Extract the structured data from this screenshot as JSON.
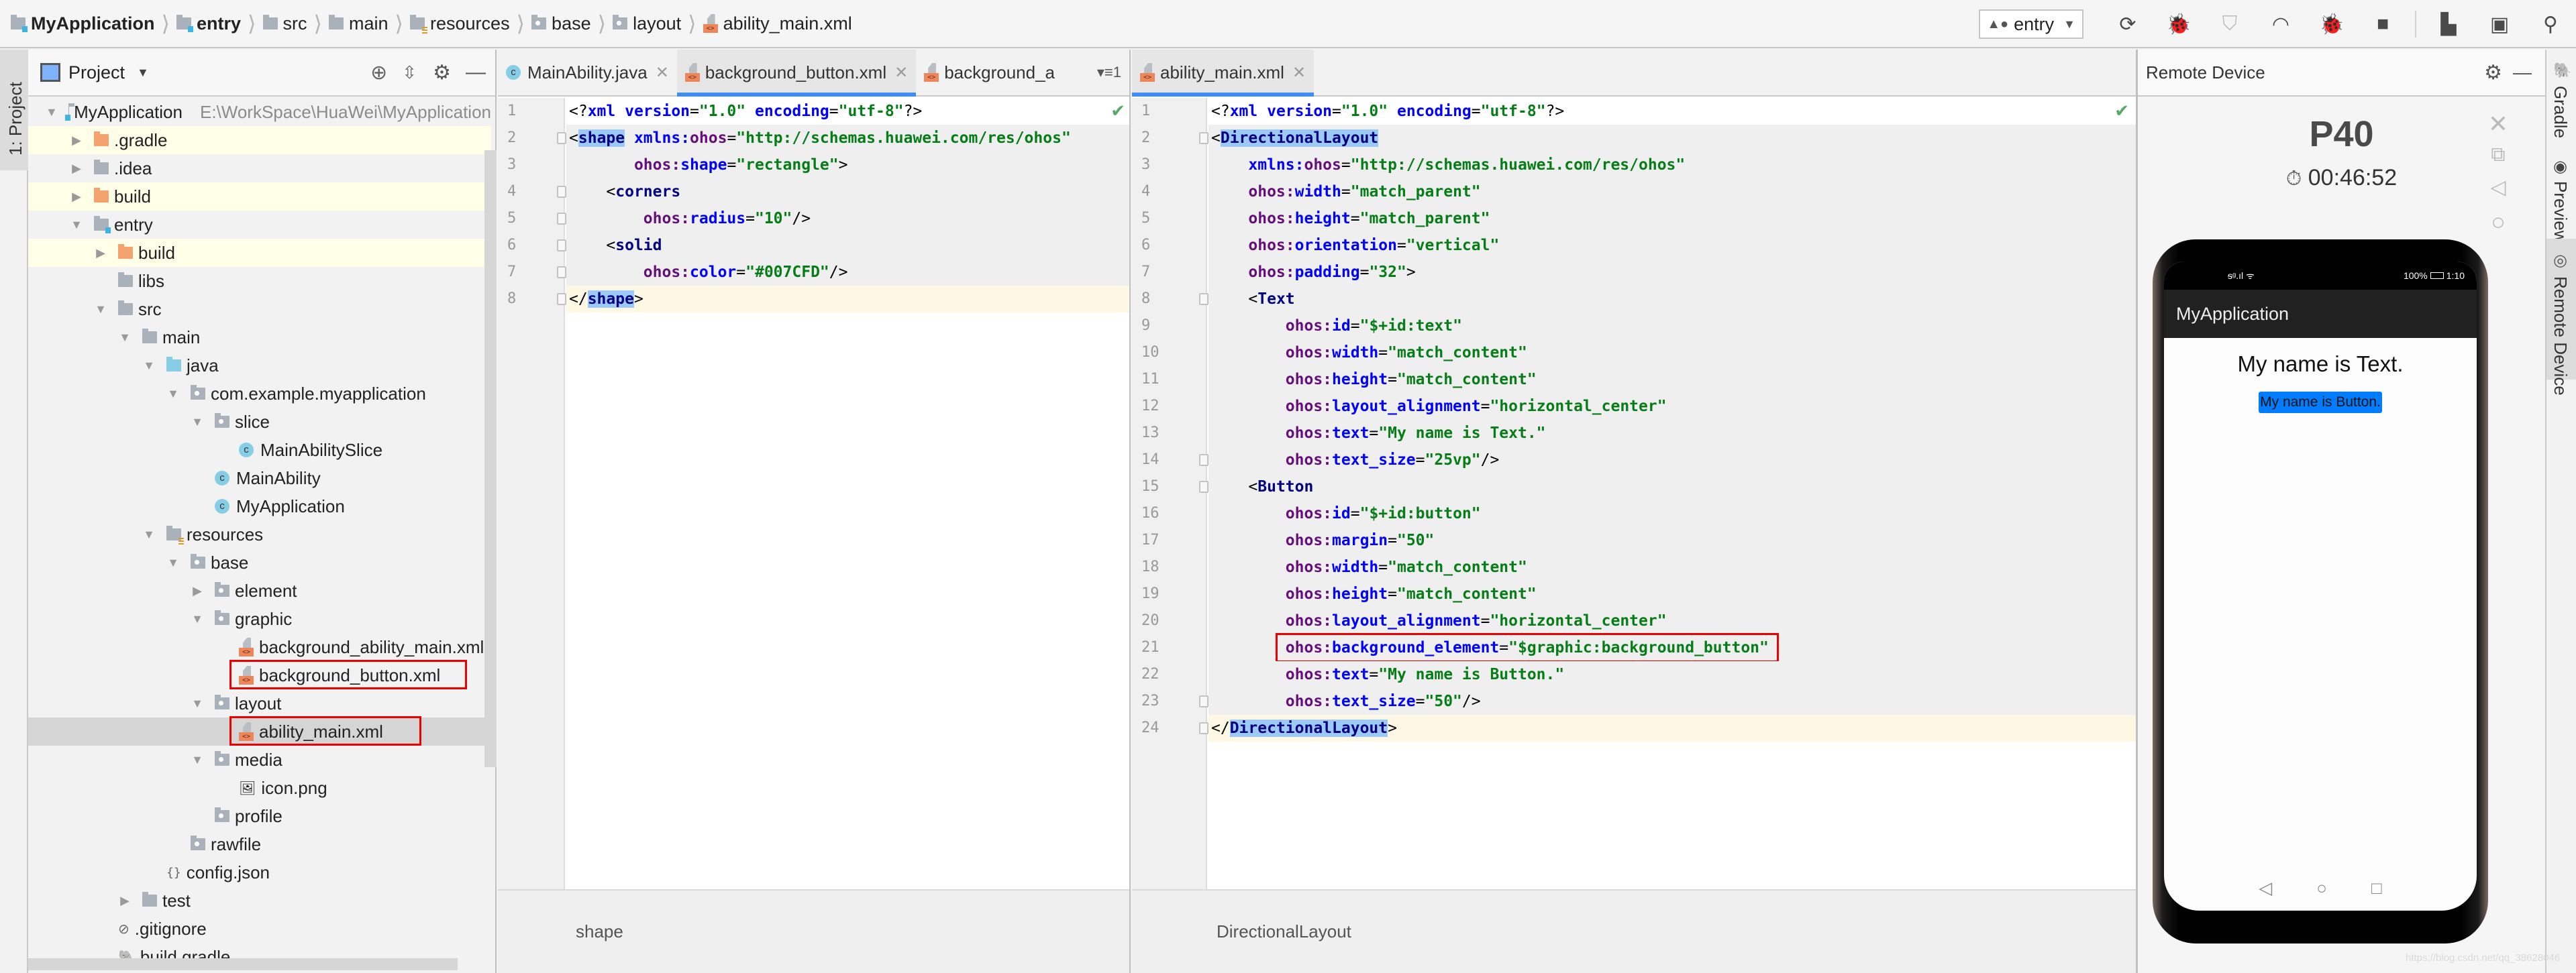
{
  "breadcrumb": {
    "items": [
      {
        "label": "MyApplication",
        "icon": "module-folder-icon",
        "bold": true
      },
      {
        "label": "entry",
        "icon": "module-folder-icon",
        "bold": true
      },
      {
        "label": "src",
        "icon": "folder-icon"
      },
      {
        "label": "main",
        "icon": "folder-icon"
      },
      {
        "label": "resources",
        "icon": "resources-folder-icon"
      },
      {
        "label": "base",
        "icon": "package-folder-icon"
      },
      {
        "label": "layout",
        "icon": "package-folder-icon"
      },
      {
        "label": "ability_main.xml",
        "icon": "xml-file-icon"
      }
    ]
  },
  "toolbar": {
    "run_config": "entry",
    "buttons": [
      "rerun-icon",
      "debug-icon",
      "coverage-icon",
      "profile-icon",
      "attach-debugger-icon",
      "stop-icon",
      "project-structure-icon",
      "device-manager-icon",
      "search-icon"
    ]
  },
  "left_strip": {
    "project_tab": "1: Project"
  },
  "project_panel": {
    "title": "Project",
    "tree": [
      {
        "label": "MyApplication",
        "hint": "E:\\WorkSpace\\HuaWei\\MyApplication",
        "depth": 0,
        "arrow": "down",
        "icon": "module"
      },
      {
        "label": ".gradle",
        "depth": 1,
        "arrow": "right",
        "icon": "orange",
        "highlight": "yellow"
      },
      {
        "label": ".idea",
        "depth": 1,
        "arrow": "right",
        "icon": "folder"
      },
      {
        "label": "build",
        "depth": 1,
        "arrow": "right",
        "icon": "orange",
        "highlight": "yellow"
      },
      {
        "label": "entry",
        "depth": 1,
        "arrow": "down",
        "icon": "module"
      },
      {
        "label": "build",
        "depth": 2,
        "arrow": "right",
        "icon": "orange",
        "highlight": "yellow"
      },
      {
        "label": "libs",
        "depth": 2,
        "arrow": "",
        "icon": "folder"
      },
      {
        "label": "src",
        "depth": 2,
        "arrow": "down",
        "icon": "folder"
      },
      {
        "label": "main",
        "depth": 3,
        "arrow": "down",
        "icon": "folder"
      },
      {
        "label": "java",
        "depth": 4,
        "arrow": "down",
        "icon": "java"
      },
      {
        "label": "com.example.myapplication",
        "depth": 5,
        "arrow": "down",
        "icon": "package"
      },
      {
        "label": "slice",
        "depth": 6,
        "arrow": "down",
        "icon": "package"
      },
      {
        "label": "MainAbilitySlice",
        "depth": 7,
        "arrow": "",
        "icon": "class"
      },
      {
        "label": "MainAbility",
        "depth": 6,
        "arrow": "",
        "icon": "class"
      },
      {
        "label": "MyApplication",
        "depth": 6,
        "arrow": "",
        "icon": "class"
      },
      {
        "label": "resources",
        "depth": 4,
        "arrow": "down",
        "icon": "resources"
      },
      {
        "label": "base",
        "depth": 5,
        "arrow": "down",
        "icon": "package"
      },
      {
        "label": "element",
        "depth": 6,
        "arrow": "right",
        "icon": "package"
      },
      {
        "label": "graphic",
        "depth": 6,
        "arrow": "down",
        "icon": "package"
      },
      {
        "label": "background_ability_main.xml",
        "depth": 7,
        "arrow": "",
        "icon": "xml"
      },
      {
        "label": "background_button.xml",
        "depth": 7,
        "arrow": "",
        "icon": "xml",
        "boxed": true
      },
      {
        "label": "layout",
        "depth": 6,
        "arrow": "down",
        "icon": "package"
      },
      {
        "label": "ability_main.xml",
        "depth": 7,
        "arrow": "",
        "icon": "xml",
        "boxed": true,
        "selected": true
      },
      {
        "label": "media",
        "depth": 6,
        "arrow": "down",
        "icon": "package"
      },
      {
        "label": "icon.png",
        "depth": 7,
        "arrow": "",
        "icon": "image"
      },
      {
        "label": "profile",
        "depth": 6,
        "arrow": "",
        "icon": "package"
      },
      {
        "label": "rawfile",
        "depth": 5,
        "arrow": "",
        "icon": "package"
      },
      {
        "label": "config.json",
        "depth": 4,
        "arrow": "",
        "icon": "json"
      },
      {
        "label": "test",
        "depth": 3,
        "arrow": "right",
        "icon": "folder"
      },
      {
        "label": ".gitignore",
        "depth": 2,
        "arrow": "",
        "icon": "gitignore"
      },
      {
        "label": "build.gradle",
        "depth": 2,
        "arrow": "",
        "icon": "gradle"
      }
    ]
  },
  "editor_left": {
    "tabs": [
      {
        "label": "MainAbility.java",
        "icon": "class",
        "closable": true
      },
      {
        "label": "background_button.xml",
        "icon": "xml",
        "closable": true,
        "active": true
      },
      {
        "label": "background_a",
        "icon": "xml",
        "closable": false
      }
    ],
    "overflow_label": "1",
    "lines": [
      [
        [
          "pun",
          "<?"
        ],
        [
          "attr",
          "xml version"
        ],
        [
          "pun",
          "="
        ],
        [
          "val",
          "\"1.0\""
        ],
        [
          "attr",
          " encoding"
        ],
        [
          "pun",
          "="
        ],
        [
          "val",
          "\"utf-8\""
        ],
        [
          "pun",
          "?>"
        ]
      ],
      [
        [
          "pun",
          "<"
        ],
        [
          "tag",
          "shape"
        ],
        [
          "attr",
          " xmlns:"
        ],
        [
          "ns",
          "ohos"
        ],
        [
          "pun",
          "="
        ],
        [
          "val",
          "\"http://schemas.huawei.com/res/ohos\""
        ]
      ],
      [
        [
          "pun",
          "       "
        ],
        [
          "ns",
          "ohos:"
        ],
        [
          "attr",
          "shape"
        ],
        [
          "pun",
          "="
        ],
        [
          "val",
          "\"rectangle\""
        ],
        [
          "pun",
          ">"
        ]
      ],
      [
        [
          "pun",
          "    <"
        ],
        [
          "tag",
          "corners"
        ]
      ],
      [
        [
          "pun",
          "        "
        ],
        [
          "ns",
          "ohos:"
        ],
        [
          "attr",
          "radius"
        ],
        [
          "pun",
          "="
        ],
        [
          "val",
          "\"10\""
        ],
        [
          "pun",
          "/>"
        ]
      ],
      [
        [
          "pun",
          "    <"
        ],
        [
          "tag",
          "solid"
        ]
      ],
      [
        [
          "pun",
          "        "
        ],
        [
          "ns",
          "ohos:"
        ],
        [
          "attr",
          "color"
        ],
        [
          "pun",
          "="
        ],
        [
          "val",
          "\"#007CFD\""
        ],
        [
          "pun",
          "/>"
        ]
      ],
      [
        [
          "pun",
          "</"
        ],
        [
          "tag",
          "shape"
        ],
        [
          "pun",
          ">"
        ]
      ]
    ],
    "breadcrumb": "shape"
  },
  "editor_right": {
    "tabs": [
      {
        "label": "ability_main.xml",
        "icon": "xml",
        "closable": true,
        "active": true
      }
    ],
    "lines": [
      [
        [
          "pun",
          "<?"
        ],
        [
          "attr",
          "xml version"
        ],
        [
          "pun",
          "="
        ],
        [
          "val",
          "\"1.0\""
        ],
        [
          "attr",
          " encoding"
        ],
        [
          "pun",
          "="
        ],
        [
          "val",
          "\"utf-8\""
        ],
        [
          "pun",
          "?>"
        ]
      ],
      [
        [
          "pun",
          "<"
        ],
        [
          "tag",
          "DirectionalLayout"
        ]
      ],
      [
        [
          "pun",
          "    "
        ],
        [
          "attr",
          "xmlns:"
        ],
        [
          "ns",
          "ohos"
        ],
        [
          "pun",
          "="
        ],
        [
          "val",
          "\"http://schemas.huawei.com/res/ohos\""
        ]
      ],
      [
        [
          "pun",
          "    "
        ],
        [
          "ns",
          "ohos:"
        ],
        [
          "attr",
          "width"
        ],
        [
          "pun",
          "="
        ],
        [
          "val",
          "\"match_parent\""
        ]
      ],
      [
        [
          "pun",
          "    "
        ],
        [
          "ns",
          "ohos:"
        ],
        [
          "attr",
          "height"
        ],
        [
          "pun",
          "="
        ],
        [
          "val",
          "\"match_parent\""
        ]
      ],
      [
        [
          "pun",
          "    "
        ],
        [
          "ns",
          "ohos:"
        ],
        [
          "attr",
          "orientation"
        ],
        [
          "pun",
          "="
        ],
        [
          "val",
          "\"vertical\""
        ]
      ],
      [
        [
          "pun",
          "    "
        ],
        [
          "ns",
          "ohos:"
        ],
        [
          "attr",
          "padding"
        ],
        [
          "pun",
          "="
        ],
        [
          "val",
          "\"32\""
        ],
        [
          "pun",
          ">"
        ]
      ],
      [
        [
          "pun",
          "    <"
        ],
        [
          "tag",
          "Text"
        ]
      ],
      [
        [
          "pun",
          "        "
        ],
        [
          "ns",
          "ohos:"
        ],
        [
          "attr",
          "id"
        ],
        [
          "pun",
          "="
        ],
        [
          "val",
          "\"$+id:text\""
        ]
      ],
      [
        [
          "pun",
          "        "
        ],
        [
          "ns",
          "ohos:"
        ],
        [
          "attr",
          "width"
        ],
        [
          "pun",
          "="
        ],
        [
          "val",
          "\"match_content\""
        ]
      ],
      [
        [
          "pun",
          "        "
        ],
        [
          "ns",
          "ohos:"
        ],
        [
          "attr",
          "height"
        ],
        [
          "pun",
          "="
        ],
        [
          "val",
          "\"match_content\""
        ]
      ],
      [
        [
          "pun",
          "        "
        ],
        [
          "ns",
          "ohos:"
        ],
        [
          "attr",
          "layout_alignment"
        ],
        [
          "pun",
          "="
        ],
        [
          "val",
          "\"horizontal_center\""
        ]
      ],
      [
        [
          "pun",
          "        "
        ],
        [
          "ns",
          "ohos:"
        ],
        [
          "attr",
          "text"
        ],
        [
          "pun",
          "="
        ],
        [
          "val",
          "\"My name is Text.\""
        ]
      ],
      [
        [
          "pun",
          "        "
        ],
        [
          "ns",
          "ohos:"
        ],
        [
          "attr",
          "text_size"
        ],
        [
          "pun",
          "="
        ],
        [
          "val",
          "\"25vp\""
        ],
        [
          "pun",
          "/>"
        ]
      ],
      [
        [
          "pun",
          "    <"
        ],
        [
          "tag",
          "Button"
        ]
      ],
      [
        [
          "pun",
          "        "
        ],
        [
          "ns",
          "ohos:"
        ],
        [
          "attr",
          "id"
        ],
        [
          "pun",
          "="
        ],
        [
          "val",
          "\"$+id:button\""
        ]
      ],
      [
        [
          "pun",
          "        "
        ],
        [
          "ns",
          "ohos:"
        ],
        [
          "attr",
          "margin"
        ],
        [
          "pun",
          "="
        ],
        [
          "val",
          "\"50\""
        ]
      ],
      [
        [
          "pun",
          "        "
        ],
        [
          "ns",
          "ohos:"
        ],
        [
          "attr",
          "width"
        ],
        [
          "pun",
          "="
        ],
        [
          "val",
          "\"match_content\""
        ]
      ],
      [
        [
          "pun",
          "        "
        ],
        [
          "ns",
          "ohos:"
        ],
        [
          "attr",
          "height"
        ],
        [
          "pun",
          "="
        ],
        [
          "val",
          "\"match_content\""
        ]
      ],
      [
        [
          "pun",
          "        "
        ],
        [
          "ns",
          "ohos:"
        ],
        [
          "attr",
          "layout_alignment"
        ],
        [
          "pun",
          "="
        ],
        [
          "val",
          "\"horizontal_center\""
        ]
      ],
      [
        [
          "pun",
          "        "
        ],
        [
          "ns",
          "ohos:"
        ],
        [
          "attr",
          "background_element"
        ],
        [
          "pun",
          "="
        ],
        [
          "val",
          "\"$graphic:background_button\""
        ]
      ],
      [
        [
          "pun",
          "        "
        ],
        [
          "ns",
          "ohos:"
        ],
        [
          "attr",
          "text"
        ],
        [
          "pun",
          "="
        ],
        [
          "val",
          "\"My name is Button.\""
        ]
      ],
      [
        [
          "pun",
          "        "
        ],
        [
          "ns",
          "ohos:"
        ],
        [
          "attr",
          "text_size"
        ],
        [
          "pun",
          "="
        ],
        [
          "val",
          "\"50\""
        ],
        [
          "pun",
          "/>"
        ]
      ],
      [
        [
          "pun",
          "</"
        ],
        [
          "tag",
          "DirectionalLayout"
        ],
        [
          "pun",
          ">"
        ]
      ]
    ],
    "boxed_line": 21,
    "breadcrumb": "DirectionalLayout"
  },
  "remote_device": {
    "title": "Remote Device",
    "device_name": "P40",
    "timer": "00:46:52",
    "phone": {
      "status_battery": "100%",
      "status_time": "1:10",
      "app_title": "MyApplication",
      "text": "My name is Text.",
      "button_label": "My name is Button.",
      "button_color": "#007CFD"
    }
  },
  "right_strip": {
    "tabs": [
      "Gradle",
      "Previewer",
      "Remote Device"
    ]
  },
  "watermark": "https://blog.csdn.net/qq_38628046"
}
